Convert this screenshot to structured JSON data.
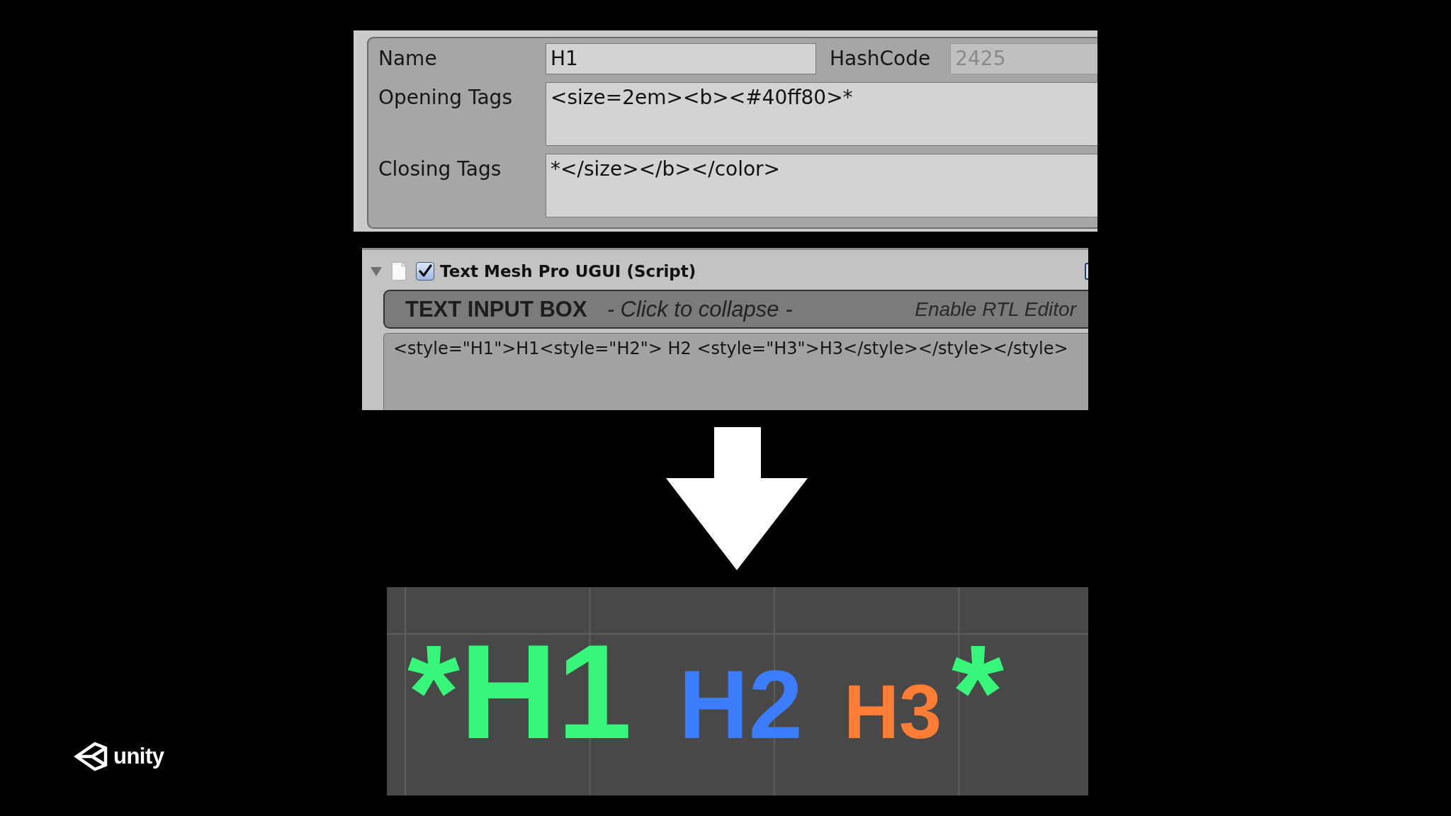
{
  "style_editor": {
    "name": {
      "label": "Name",
      "value": "H1"
    },
    "hash_code": {
      "label": "HashCode",
      "value": "2425",
      "disabled": true
    },
    "opening_tags": {
      "label": "Opening Tags",
      "value": "<size=2em><b><#40ff80>*"
    },
    "closing_tags": {
      "label": "Closing Tags",
      "value": "*</size></b></color>"
    }
  },
  "component": {
    "expanded": true,
    "checked": true,
    "title": "Text Mesh Pro UGUI (Script)",
    "section": {
      "title": "TEXT INPUT BOX",
      "hint": "- Click to collapse -",
      "rtl_toggle": "Enable RTL Editor"
    },
    "text_input": {
      "value": "<style=\"H1\">H1<style=\"H2\"> H2 <style=\"H3\">H3</style></style></style>"
    }
  },
  "preview": {
    "segments": [
      {
        "text": "*H1",
        "kind": "h1",
        "color": "#38f67a"
      },
      {
        "text": "H2",
        "kind": "h2",
        "color": "#3c7dff"
      },
      {
        "text": "H3",
        "kind": "h3",
        "color": "#ff7d35"
      },
      {
        "text": "*",
        "kind": "h1",
        "color": "#38f67a"
      }
    ]
  },
  "logo": {
    "text": "unity"
  }
}
